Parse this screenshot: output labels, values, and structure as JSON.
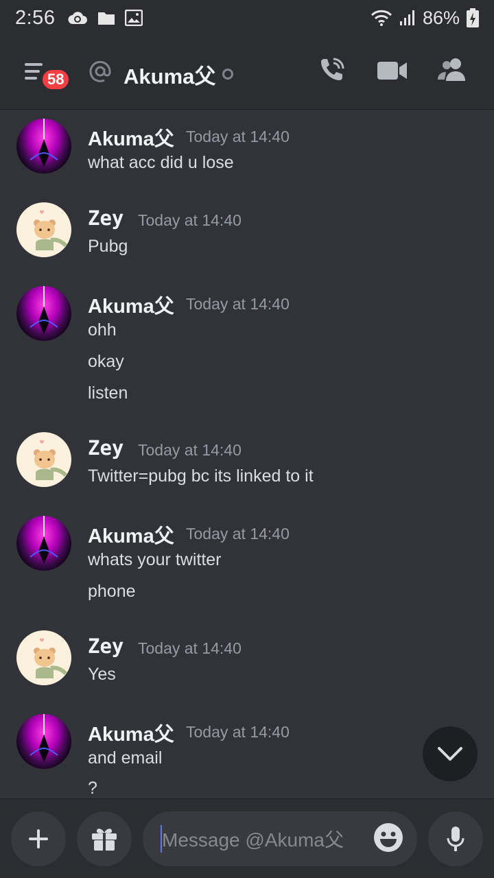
{
  "status_bar": {
    "time": "2:56",
    "battery": "86%",
    "icons": [
      "cloud-sync-icon",
      "folder-icon",
      "image-icon",
      "wifi-icon",
      "signal-icon",
      "battery-charging-icon"
    ]
  },
  "header": {
    "badge_count": "58",
    "title": "Akuma父",
    "icons": [
      "menu-icon",
      "at-icon",
      "phone-call-icon",
      "video-call-icon",
      "members-icon"
    ]
  },
  "messages": [
    {
      "author": "Akuma父",
      "time": "Today at 14:40",
      "avatar": "akuma",
      "lines": [
        "what acc did u lose"
      ]
    },
    {
      "author": "Zey",
      "time": "Today at 14:40",
      "avatar": "zey",
      "lines": [
        "Pubg"
      ]
    },
    {
      "author": "Akuma父",
      "time": "Today at 14:40",
      "avatar": "akuma",
      "lines": [
        "ohh",
        "okay",
        "listen"
      ]
    },
    {
      "author": "Zey",
      "time": "Today at 14:40",
      "avatar": "zey",
      "lines": [
        "Twitter=pubg bc its linked to it"
      ]
    },
    {
      "author": "Akuma父",
      "time": "Today at 14:40",
      "avatar": "akuma",
      "lines": [
        "whats your twitter",
        "phone"
      ]
    },
    {
      "author": "Zey",
      "time": "Today at 14:40",
      "avatar": "zey",
      "lines": [
        "Yes"
      ]
    },
    {
      "author": "Akuma父",
      "time": "Today at 14:40",
      "avatar": "akuma",
      "lines": [
        "and email",
        "?"
      ]
    }
  ],
  "composer": {
    "placeholder": "Message @Akuma父",
    "icons": [
      "plus-icon",
      "gift-icon",
      "emoji-icon",
      "microphone-icon"
    ]
  },
  "colors": {
    "background": "#313338",
    "header_bg": "#2b2d31",
    "badge": "#f23f43",
    "timestamp": "#949ba4"
  }
}
